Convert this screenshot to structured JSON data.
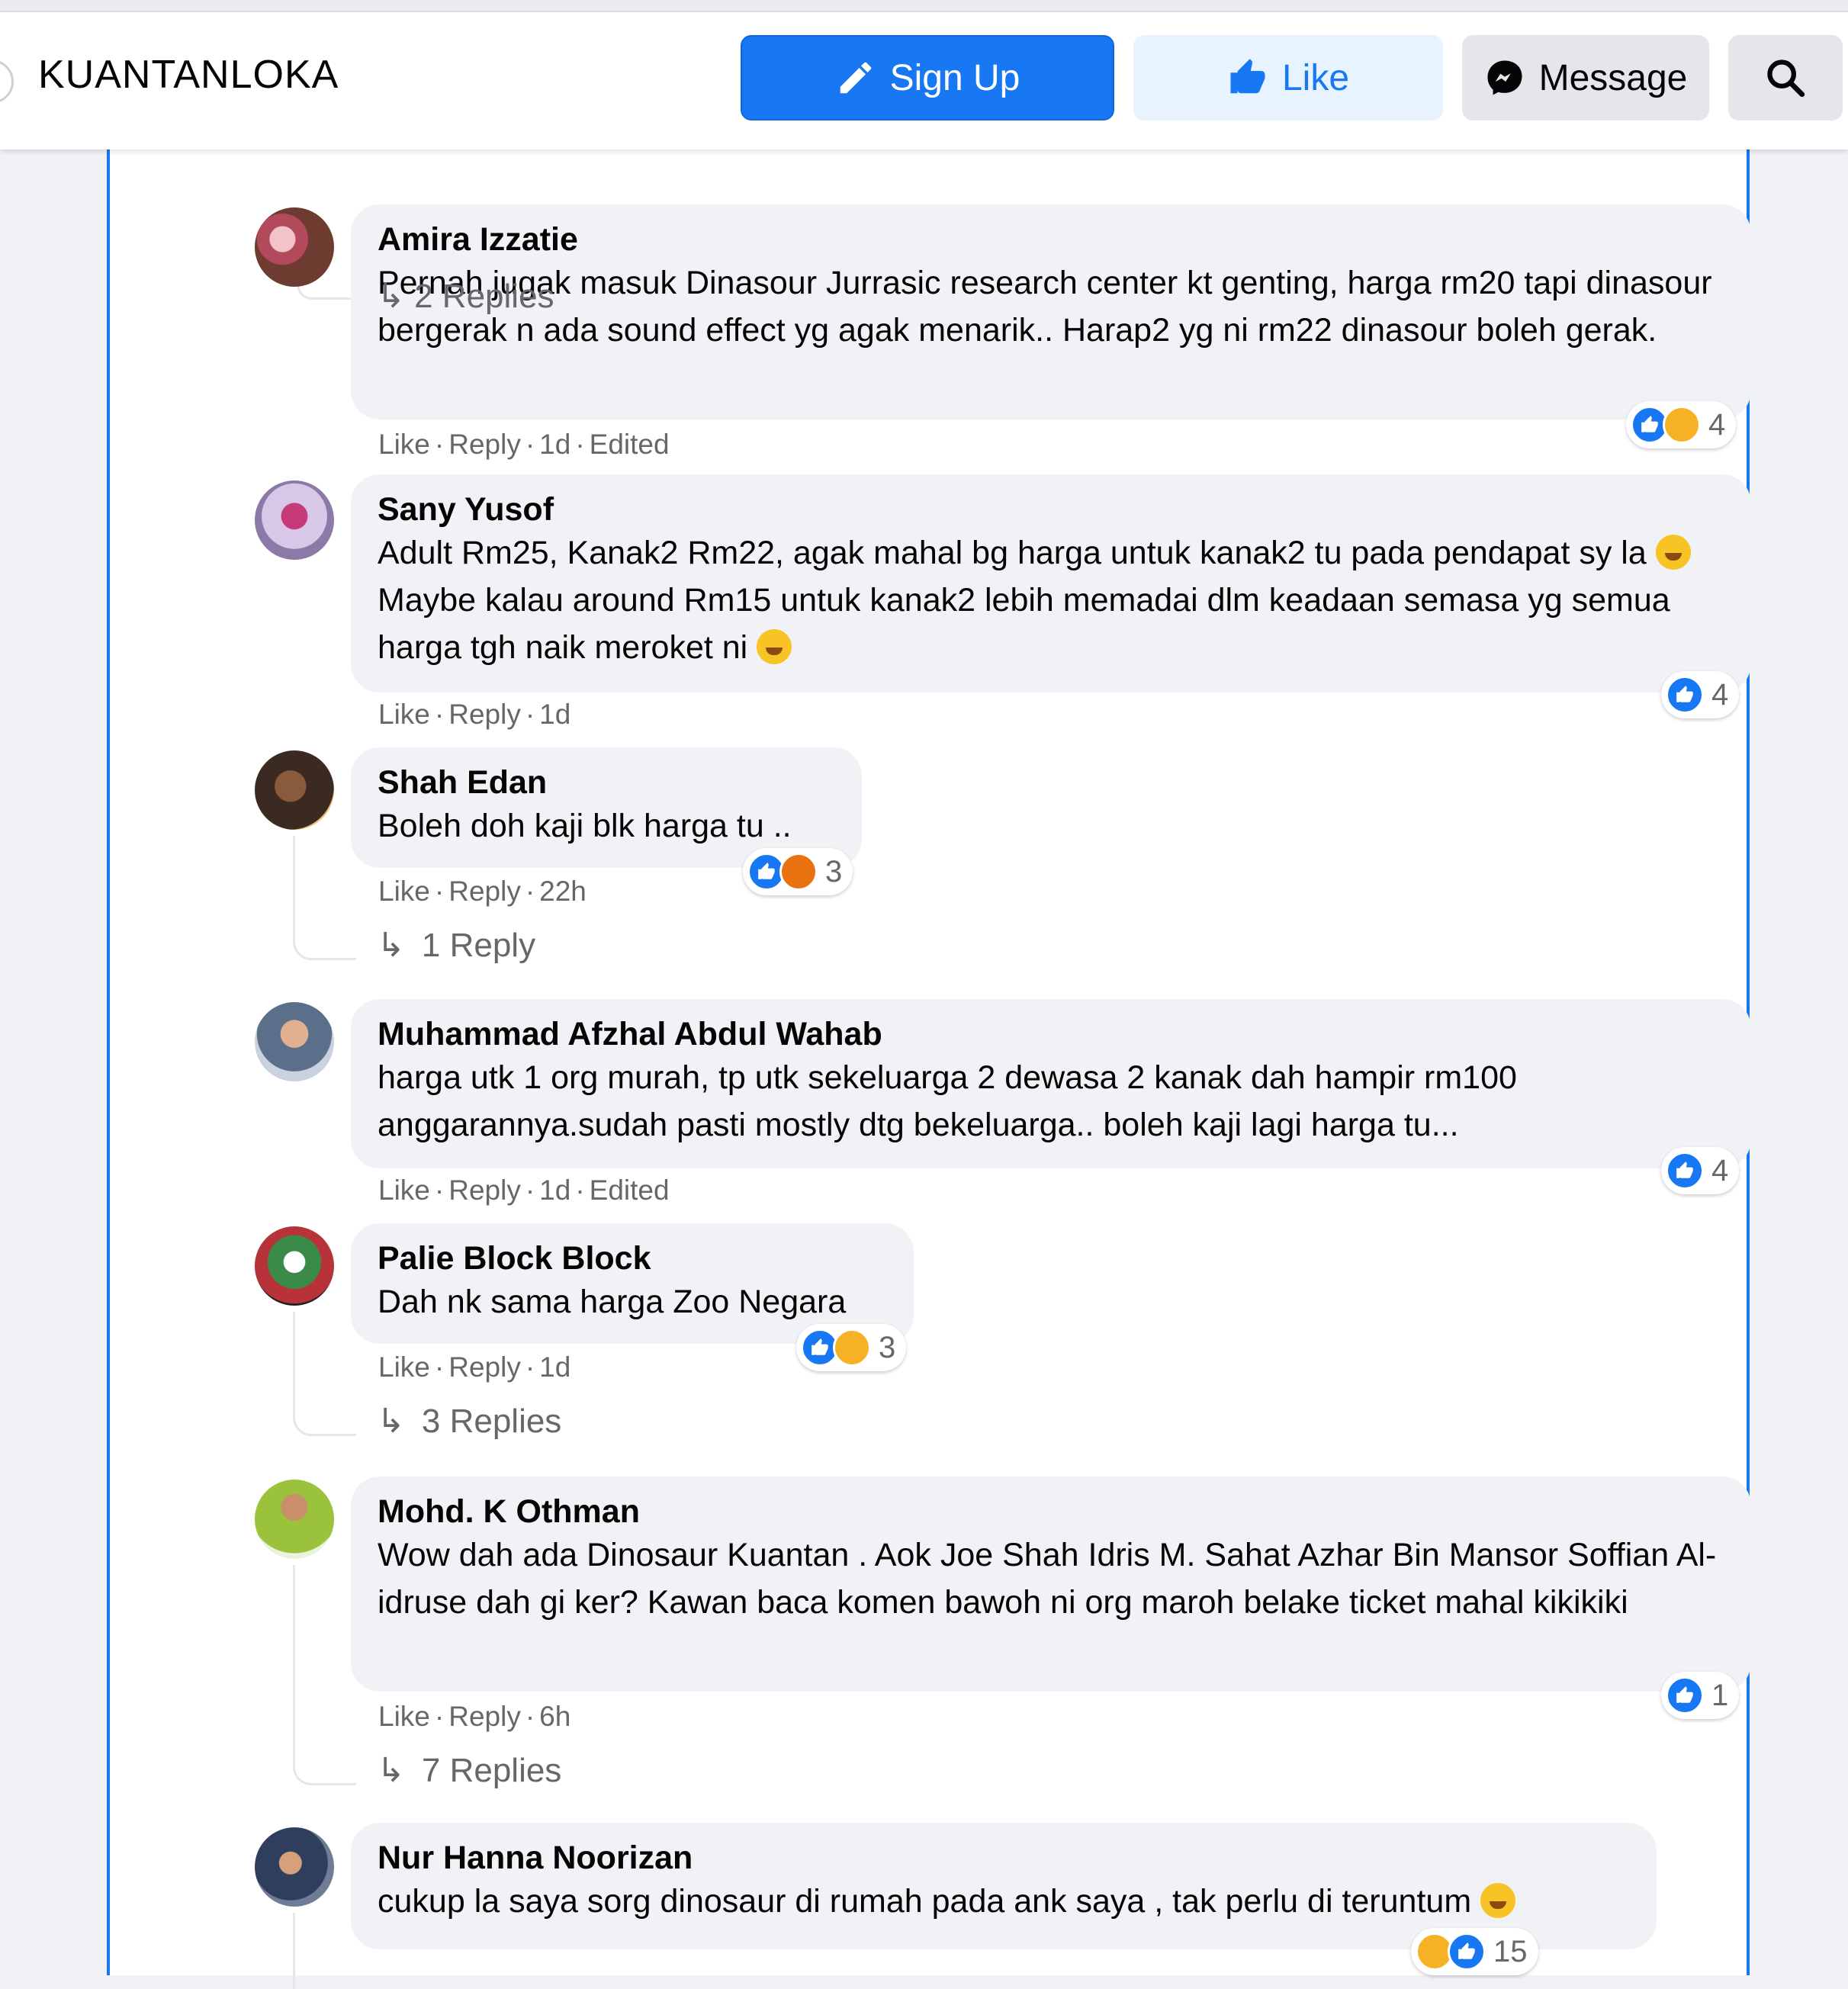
{
  "header": {
    "page_name": "KUANTANLOKA",
    "signup_label": "Sign Up",
    "like_label": "Like",
    "message_label": "Message"
  },
  "previous_replies": "2 Replies",
  "comments": [
    {
      "name": "Amira Izzatie",
      "text": "Pernah jugak masuk Dinasour Jurrasic research center kt genting, harga rm20 tapi dinasour bergerak n ada sound effect yg agak menarik.. Harap2 yg ni rm22 dinasour boleh gerak.",
      "like": "Like",
      "reply": "Reply",
      "time": "1d",
      "edited": "Edited",
      "reaction_count": "4"
    },
    {
      "name": "Sany Yusof",
      "text_a": "Adult Rm25, Kanak2 Rm22, agak mahal bg harga untuk kanak2 tu pada pendapat sy la",
      "text_b": "Maybe kalau around Rm15 untuk kanak2 lebih memadai dlm keadaan semasa yg semua harga tgh naik meroket ni",
      "like": "Like",
      "reply": "Reply",
      "time": "1d",
      "reaction_count": "4"
    },
    {
      "name": "Shah Edan",
      "text": "Boleh doh kaji blk harga tu ..",
      "like": "Like",
      "reply": "Reply",
      "time": "22h",
      "reaction_count": "3",
      "replies": "1 Reply"
    },
    {
      "name": "Muhammad Afzhal Abdul Wahab",
      "text": "harga utk 1 org murah, tp utk sekeluarga 2 dewasa 2 kanak dah hampir rm100 anggarannya.sudah pasti mostly dtg bekeluarga.. boleh kaji lagi harga tu...",
      "like": "Like",
      "reply": "Reply",
      "time": "1d",
      "edited": "Edited",
      "reaction_count": "4"
    },
    {
      "name": "Palie Block Block",
      "text": "Dah nk sama harga Zoo Negara",
      "like": "Like",
      "reply": "Reply",
      "time": "1d",
      "reaction_count": "3",
      "replies": "3 Replies"
    },
    {
      "name": "Mohd. K Othman",
      "text": "Wow dah ada Dinosaur Kuantan . Aok Joe Shah Idris M. Sahat Azhar Bin Mansor Soffian Al-idruse dah gi ker? Kawan baca komen bawoh ni org maroh belake ticket mahal kikikiki",
      "like": "Like",
      "reply": "Reply",
      "time": "6h",
      "reaction_count": "1",
      "replies": "7 Replies"
    },
    {
      "name": "Nur Hanna Noorizan",
      "text": "cukup la saya sorg dinosaur di rumah pada ank saya , tak perlu di teruntum",
      "reaction_count": "15"
    }
  ],
  "colors": {
    "accent": "#1877f2",
    "bubble": "#f0f2f5",
    "meta": "#65676b"
  },
  "icons": [
    "pencil-icon",
    "thumbs-up-icon",
    "messenger-icon",
    "search-icon",
    "reply-arrow-icon"
  ]
}
